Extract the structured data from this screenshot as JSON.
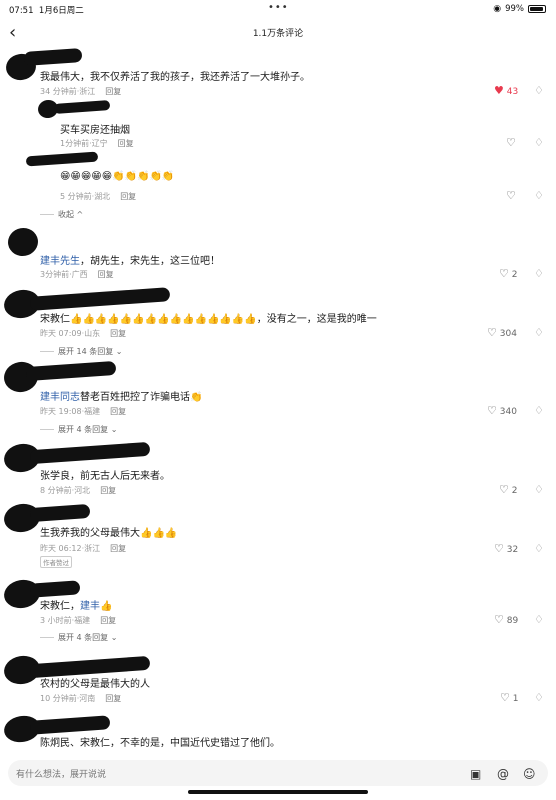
{
  "status": {
    "time": "07:51",
    "date": "1月6日周二",
    "battery": "99%"
  },
  "header": {
    "title": "1.1万条评论"
  },
  "comments": [
    {
      "text": "我最伟大，我不仅养活了我的孩子，我还养活了一大堆孙子。",
      "time": "34 分钟前",
      "loc": "浙江",
      "reply": "回复",
      "likes": "43"
    },
    {
      "text": "买车买房还抽烟",
      "time": "1分钟前",
      "loc": "辽宁",
      "reply": "回复"
    },
    {
      "emojis": "😁😁😁😁😁👏👏👏👏👏",
      "time": "5 分钟前",
      "loc": "湖北",
      "reply": "回复",
      "collapse": "收起"
    },
    {
      "mention": "建丰先生",
      "text": "，胡先生，宋先生，这三位吧！",
      "time": "3分钟前",
      "loc": "广西",
      "reply": "回复",
      "likes": "2"
    },
    {
      "text": "宋教仁👍👍👍👍👍👍👍👍👍👍👍👍👍👍👍，没有之一，这是我的唯一",
      "time": "昨天 07:09",
      "loc": "山东",
      "reply": "回复",
      "likes": "304",
      "expand": "展开 14 条回复"
    },
    {
      "mention": "建丰同志",
      "text": "替老百姓把控了诈骗电话👏",
      "time": "昨天 19:08",
      "loc": "福建",
      "reply": "回复",
      "likes": "340",
      "expand": "展开 4 条回复"
    },
    {
      "text": "张学良，前无古人后无来者。",
      "time": "8 分钟前",
      "loc": "河北",
      "reply": "回复",
      "likes": "2"
    },
    {
      "text": "生我养我的父母最伟大👍👍👍",
      "time": "昨天 06:12",
      "loc": "浙江",
      "reply": "回复",
      "likes": "32",
      "tag": "作者赞过"
    },
    {
      "text": "宋教仁，",
      "mention": "建丰",
      "emoji": "👍",
      "time": "3 小时前",
      "loc": "福建",
      "reply": "回复",
      "likes": "89",
      "expand": "展开 4 条回复"
    },
    {
      "text": "农村的父母是最伟大的人",
      "time": "10 分钟前",
      "loc": "河南",
      "reply": "回复",
      "likes": "1"
    },
    {
      "text": "陈炯民、宋教仁，不幸的是，中国近代史错过了他们。"
    }
  ],
  "input": {
    "placeholder": "有什么想法，展开说说"
  },
  "icons": [
    "back-icon",
    "heart-icon",
    "dislike-icon",
    "image-icon",
    "at-icon",
    "emoji-icon",
    "wifi-icon",
    "battery-icon"
  ]
}
